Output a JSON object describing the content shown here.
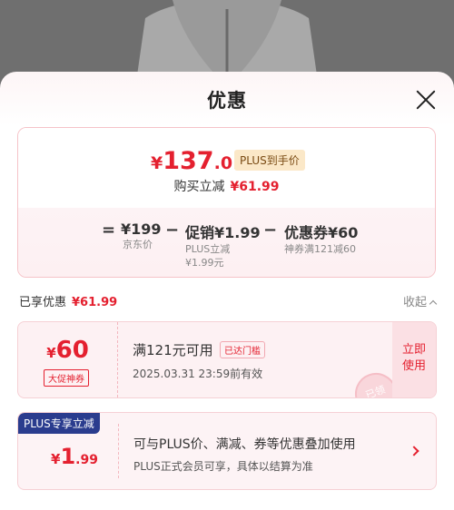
{
  "sheet": {
    "title": "优惠"
  },
  "price_card": {
    "currency": "¥",
    "final_int": "137",
    "final_dec": ".01",
    "plus_tag": "PLUS到手价",
    "instant_label": "购买立减",
    "instant_value": "¥61.99",
    "calc": {
      "eq": "=",
      "minus": "−",
      "original": {
        "amount": "¥199",
        "label": "京东价"
      },
      "promo": {
        "amount": "促销¥1.99",
        "label1": "PLUS立减",
        "label2": "¥1.99元"
      },
      "coupon": {
        "amount": "优惠券¥60",
        "label": "神券满121减60"
      }
    }
  },
  "enjoyed": {
    "label": "已享优惠",
    "value": "¥61.99",
    "collapse_label": "收起"
  },
  "coupon": {
    "currency": "¥",
    "amount": "60",
    "type": "大促神券",
    "condition": "满121元可用",
    "met_tag": "已达门槛",
    "validity": "2025.03.31  23:59前有效",
    "action_line1": "立即",
    "action_line2": "使用",
    "stamp": "已领"
  },
  "plus": {
    "badge": "PLUS专享立减",
    "currency": "¥",
    "amount_int": "1",
    "amount_dec": ".99",
    "line1": "可与PLUS价、满减、券等优惠叠加使用",
    "line2": "PLUS正式会员可享，具体以结算为准"
  },
  "colors": {
    "accent": "#e4202f",
    "plus_blue": "#2a3c8e",
    "gold": "#fbe8c8"
  }
}
